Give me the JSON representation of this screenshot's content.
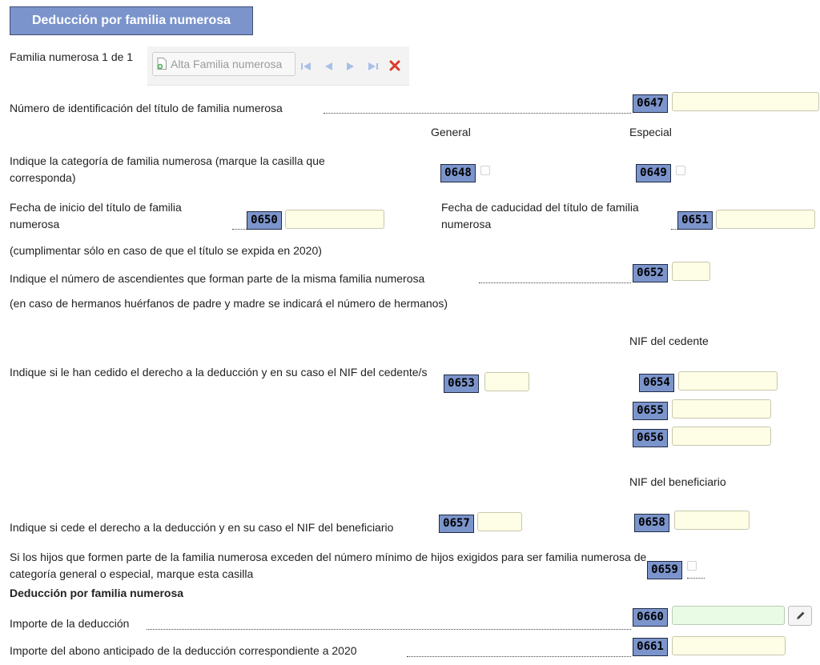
{
  "header": {
    "title": "Deducción por familia numerosa"
  },
  "nav": {
    "counter": "Familia numerosa 1 de 1",
    "add_button": "Alta Familia numerosa",
    "first_icon": "first-page-icon",
    "prev_icon": "previous-icon",
    "next_icon": "next-icon",
    "last_icon": "last-page-icon",
    "delete_icon": "delete-icon"
  },
  "columns": {
    "general": "General",
    "especial": "Especial"
  },
  "fields": {
    "titulo": {
      "label": "Número de identificación del título de familia numerosa",
      "code": "0647",
      "value": ""
    },
    "categoria": {
      "label": "Indique la categoría de familia numerosa (marque la casilla que corresponda)",
      "code_general": "0648",
      "code_especial": "0649",
      "general_checked": false,
      "especial_checked": false
    },
    "fecha_inicio": {
      "label": "Fecha de inicio del título de familia numerosa",
      "code": "0650",
      "value": ""
    },
    "fecha_caducidad": {
      "label": "Fecha de caducidad del título de familia numerosa",
      "code": "0651",
      "value": ""
    },
    "nota_2020": "(cumplimentar sólo en caso de que el título se expida en 2020)",
    "ascendientes": {
      "label": "Indique el número de ascendientes que forman parte de la misma familia numerosa",
      "code": "0652",
      "value": ""
    },
    "nota_huerfanos": "(en caso de hermanos huérfanos de padre y madre se indicará el número de hermanos)",
    "cedente_header": "NIF del cedente",
    "cedido": {
      "label": "Indique si le han cedido el derecho a la deducción y en su caso el NIF del cedente/s",
      "code": "0653",
      "value": ""
    },
    "nif_cedente": [
      {
        "code": "0654",
        "value": ""
      },
      {
        "code": "0655",
        "value": ""
      },
      {
        "code": "0656",
        "value": ""
      }
    ],
    "beneficiario_header": "NIF del beneficiario",
    "cede": {
      "label": "Indique si cede el derecho a la deducción y en su caso el NIF del beneficiario",
      "code": "0657",
      "value": ""
    },
    "nif_beneficiario": {
      "code": "0658",
      "value": ""
    },
    "hijos": {
      "label": "Si los hijos que formen parte de la familia numerosa exceden del número mínimo de hijos exigidos para ser familia numerosa de categoría general o especial, marque esta casilla",
      "code": "0659",
      "checked": false
    },
    "section_title": "Deducción por familia numerosa",
    "importe": {
      "label": "Importe de la deducción",
      "code": "0660",
      "value": "",
      "edit_icon": "pencil-icon"
    },
    "abono": {
      "label": "Importe del abono anticipado de la deducción correspondiente a 2020",
      "code": "0661",
      "value": ""
    }
  }
}
